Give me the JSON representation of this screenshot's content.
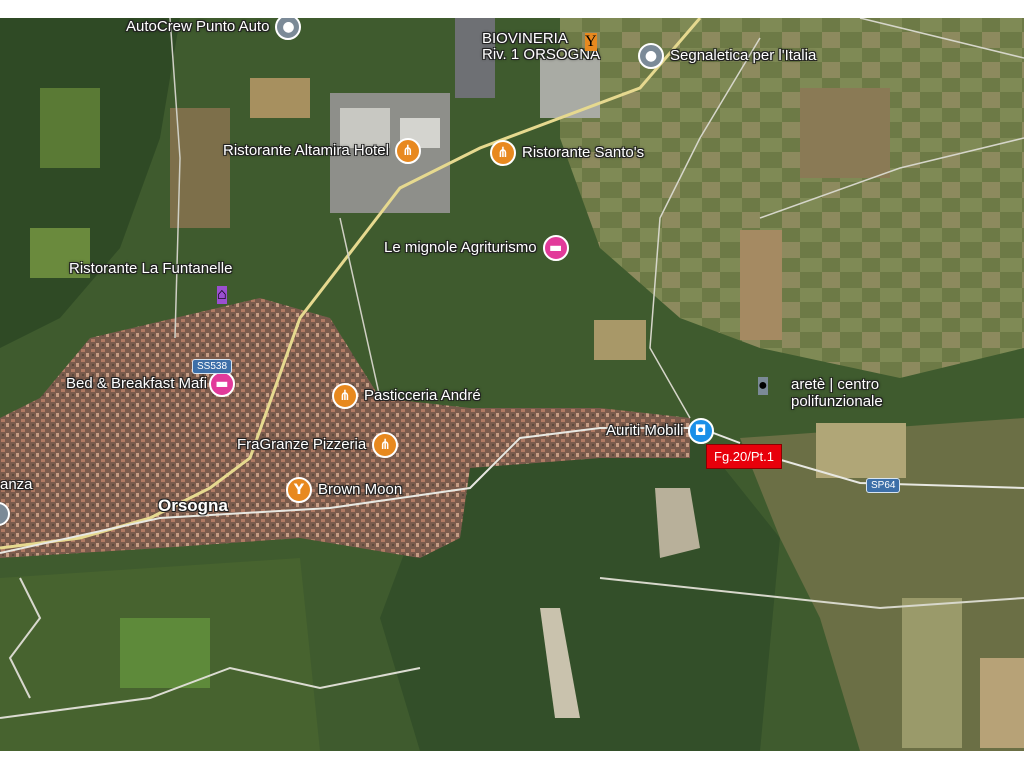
{
  "colors": {
    "food": "#e8891f",
    "lodging": "#e23a9a",
    "attraction": "#9b4fd1",
    "generic": "#7b8a97",
    "shopping": "#1a8fe8",
    "parcel": "#e8000b",
    "road_shield": "#3d6fa8"
  },
  "places": [
    {
      "name": "AutoCrew Punto Auto",
      "icon": "location-icon"
    },
    {
      "name": "BIOVINERIA Riv. 1 ORSOGNA",
      "line1": "BIOVINERIA",
      "line2": "Riv. 1 ORSOGNA",
      "icon": "cocktail-icon"
    },
    {
      "name": "Segnaletica per l'Italia",
      "icon": "location-icon"
    },
    {
      "name": "Ristorante Altamira Hotel",
      "icon": "restaurant-icon"
    },
    {
      "name": "Ristorante Santo's",
      "icon": "restaurant-icon"
    },
    {
      "name": "Le mignole Agriturismo",
      "icon": "bed-icon"
    },
    {
      "name": "Ristorante La Funtanelle",
      "icon": "museum-icon"
    },
    {
      "name": "Bed & Breakfast Mafi",
      "icon": "bed-icon"
    },
    {
      "name": "Pasticceria André",
      "icon": "restaurant-icon"
    },
    {
      "name": "FraGranze Pizzeria",
      "icon": "restaurant-icon"
    },
    {
      "name": "Brown Moon",
      "icon": "cocktail-icon"
    },
    {
      "name": "Auriti Mobili",
      "icon": "shopping-bag-icon"
    },
    {
      "name": "aretè | centro polifunzionale",
      "line1": "aretè | centro",
      "line2": "polifunzionale",
      "icon": "location-icon"
    }
  ],
  "town": "Orsogna",
  "partial_label": "anza",
  "roads": {
    "ss": "SS538",
    "sp": "SP64"
  },
  "parcel_label": "Fg.20/Pt.1"
}
